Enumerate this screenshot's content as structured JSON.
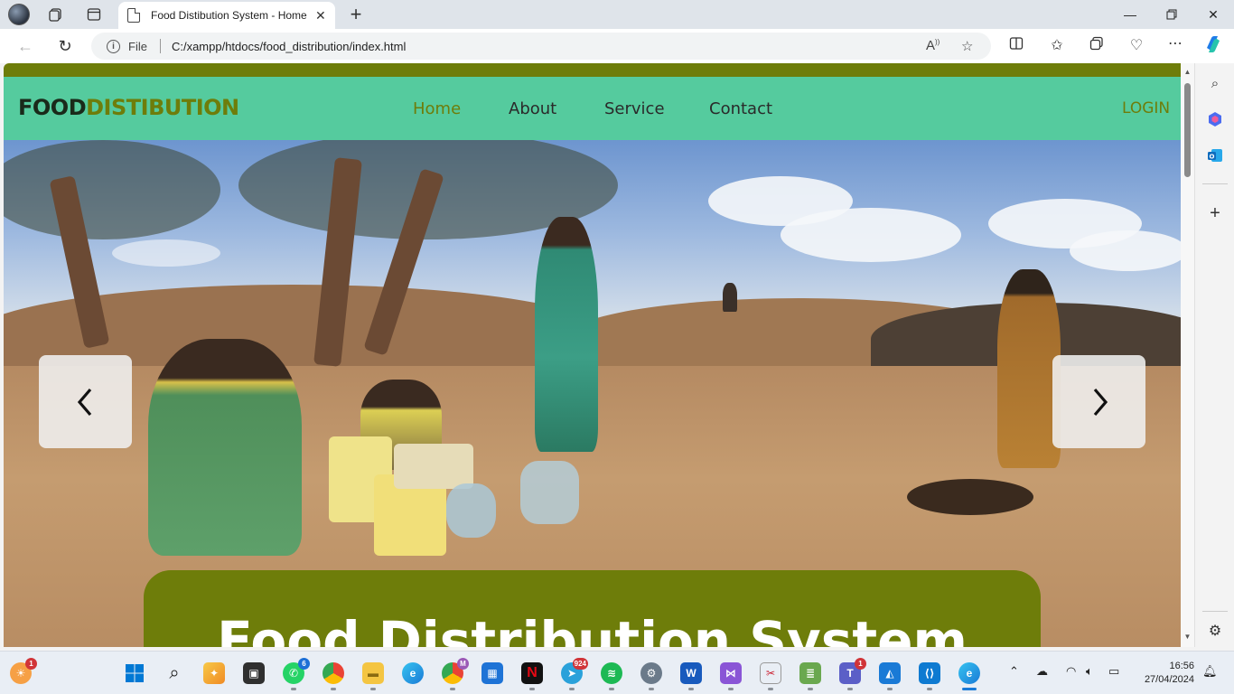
{
  "browser": {
    "tab_title": "Food Distibution System - Home",
    "url_scheme_label": "File",
    "url": "C:/xampp/htdocs/food_distribution/index.html"
  },
  "site": {
    "brand_part1": "FOOD",
    "brand_part2": "DISTIBUTION",
    "nav": [
      {
        "label": "Home",
        "active": true
      },
      {
        "label": "About",
        "active": false
      },
      {
        "label": "Service",
        "active": false
      },
      {
        "label": "Contact",
        "active": false
      }
    ],
    "login_label": "LOGIN",
    "hero_heading": "Food Distribution System",
    "colors": {
      "accent": "#6e7d0a",
      "nav_bg": "#55cb9e"
    }
  },
  "taskbar": {
    "badges": {
      "whatsapp": "6",
      "chrome_profile": "M",
      "telegram": "924",
      "teams": "1",
      "weather": "1"
    },
    "time": "16:56",
    "date": "27/04/2024"
  }
}
